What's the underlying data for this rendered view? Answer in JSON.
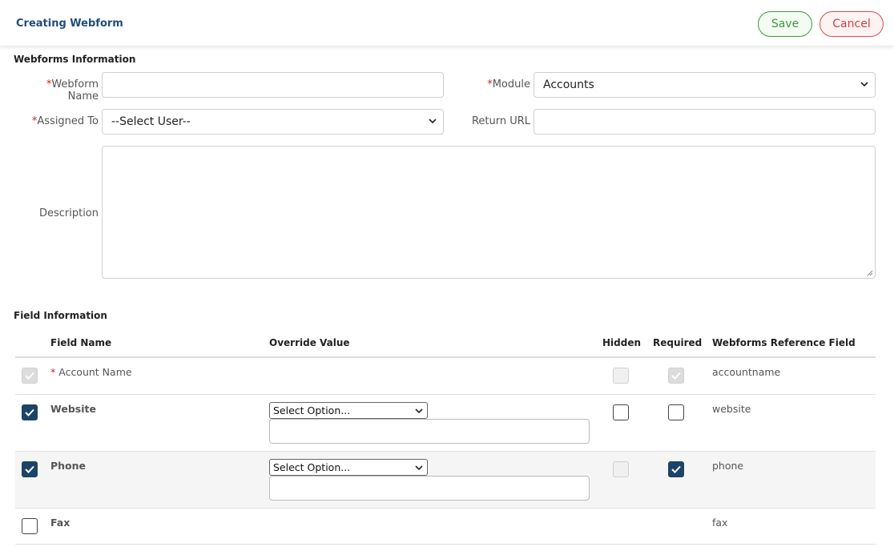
{
  "header": {
    "title": "Creating Webform",
    "save_label": "Save",
    "cancel_label": "Cancel"
  },
  "webforms_info": {
    "section_title": "Webforms Information",
    "webform_name_label": "Webform Name",
    "module_label": "Module",
    "module_value": "Accounts",
    "assigned_to_label": "Assigned To",
    "assigned_to_value": "--Select User--",
    "return_url_label": "Return URL",
    "description_label": "Description",
    "required_marker": "*"
  },
  "field_info": {
    "section_title": "Field Information",
    "columns": {
      "field_name": "Field Name",
      "override_value": "Override Value",
      "hidden": "Hidden",
      "required": "Required",
      "reference": "Webforms Reference Field"
    },
    "rows": [
      {
        "name": "Account Name",
        "required_marker": "* ",
        "reference": "accountname",
        "selected": true,
        "hidden": false,
        "required": true
      },
      {
        "name": "Website",
        "override_select": "Select Option...",
        "reference": "website",
        "selected": true,
        "hidden": false,
        "required": false
      },
      {
        "name": "Phone",
        "override_select": "Select Option...",
        "reference": "phone",
        "selected": true,
        "hidden": false,
        "required": true
      },
      {
        "name": "Fax",
        "reference": "fax",
        "selected": false
      }
    ]
  },
  "colors": {
    "title": "#1f4e79",
    "save": "#3b9c3b",
    "cancel": "#d43c3c",
    "checkbox": "#1b4466",
    "required": "#d21e1e"
  }
}
